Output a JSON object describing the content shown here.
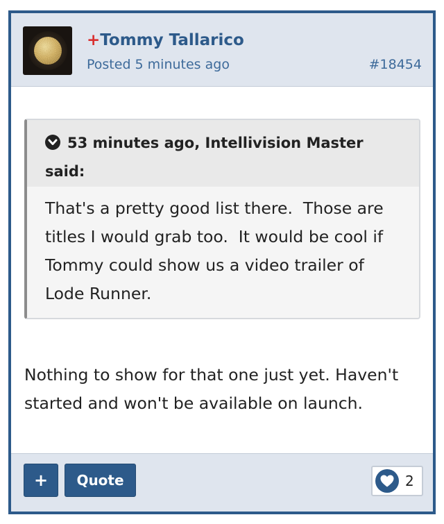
{
  "post": {
    "author_prefix": "+",
    "author_name": "Tommy Tallarico",
    "posted": "Posted 5 minutes ago",
    "post_number": "#18454"
  },
  "quote": {
    "citation": "53 minutes ago, Intellivision Master said:",
    "text": "That's a pretty good list there.  Those are titles I would grab too.  It would be cool if Tommy could show us a video trailer of Lode Runner."
  },
  "reply": {
    "text": "Nothing to show for that one just yet. Haven't started and won't be available on launch."
  },
  "footer": {
    "plus_label": "+",
    "quote_label": "Quote",
    "like_count": "2"
  },
  "icons": {
    "quote_toggle": "chevron-down-icon",
    "like": "heart-icon"
  },
  "colors": {
    "accent": "#2d5a8a",
    "author_plus": "#d93030",
    "header_bg": "#dfe5ee",
    "quote_bar": "#8c8c8c"
  }
}
